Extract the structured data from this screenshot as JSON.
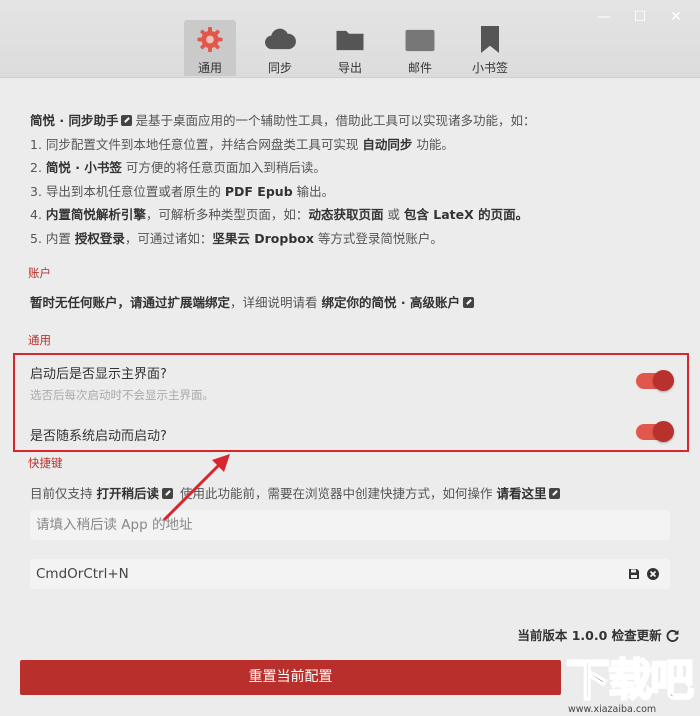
{
  "window": {
    "minimize": "—",
    "maximize": "☐",
    "close": "✕"
  },
  "tabs": [
    {
      "label": "通用",
      "icon": "gear-icon",
      "active": true
    },
    {
      "label": "同步",
      "icon": "cloud-icon"
    },
    {
      "label": "导出",
      "icon": "folder-icon"
    },
    {
      "label": "邮件",
      "icon": "mail-icon"
    },
    {
      "label": "小书签",
      "icon": "bookmark-icon"
    }
  ],
  "intro": {
    "title": "简悦 · 同步助手",
    "title_rest": "是基于桌面应用的一个辅助性工具，借助此工具可以实现诸多功能，如：",
    "l1a": "1. 同步配置文件到本地任意位置，并结合网盘类工具可实现 ",
    "l1b": "自动同步",
    "l1c": " 功能。",
    "l2a": "2. ",
    "l2b": "简悦 · 小书签",
    "l2c": " 可方便的将任意页面加入到稍后读。",
    "l3a": "3. 导出到本机任意位置或者原生的 ",
    "l3b": "PDF Epub",
    "l3c": " 输出。",
    "l4a": "4. ",
    "l4b": "内置简悦解析引擎",
    "l4c": "，可解析多种类型页面，如：",
    "l4d": "动态获取页面",
    "l4e": " 或 ",
    "l4f": "包含 LateX 的页面。",
    "l5a": "5. 内置 ",
    "l5b": "授权登录",
    "l5c": "，可通过诸如：",
    "l5d": "坚果云 Dropbox",
    "l5e": " 等方式登录简悦账户。"
  },
  "account": {
    "heading": "账户",
    "bold": "暂时无任何账户，请通过扩展端绑定",
    "rest": "，详细说明请看 ",
    "link": "绑定你的简悦 · 高级账户"
  },
  "general": {
    "heading": "通用",
    "setting1_title": "启动后是否显示主界面?",
    "setting1_desc": "选否后每次启动时不会显示主界面。",
    "setting1_on": true,
    "setting2_title": "是否随系统启动而启动?",
    "setting2_on": true
  },
  "shortcut": {
    "heading": "快捷键",
    "a": "目前仅支持 ",
    "b": "打开稍后读",
    "c": " 使用此功能前，需要在浏览器中创建快捷方式，如何操作 ",
    "d": "请看这里",
    "url_placeholder": "请填入稍后读 App 的地址",
    "hotkey_value": "CmdOrCtrl+N"
  },
  "version": {
    "label": "当前版本 1.0.0 检查更新"
  },
  "reset_label": "重置当前配置",
  "watermark": {
    "big": "下载吧",
    "url": "www.xiazaiba.com"
  }
}
